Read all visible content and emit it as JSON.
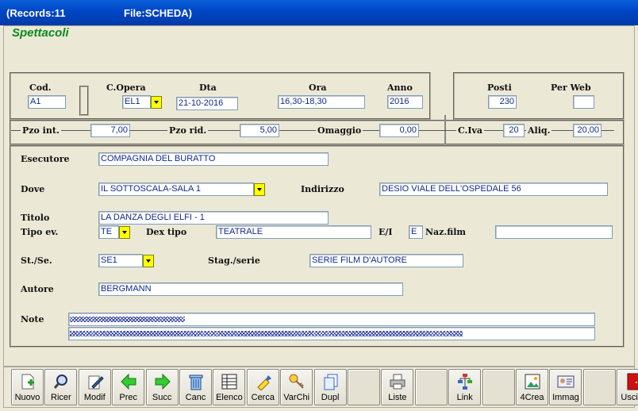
{
  "window": {
    "records": "(Records:11",
    "file": "File:SCHEDA)"
  },
  "form_title": "Spettacoli",
  "top": {
    "cod_label": "Cod.",
    "cod": "A1",
    "opera_label": "C.Opera",
    "opera": "EL1",
    "dta_label": "Dta",
    "dta": "21-10-2016",
    "ora_label": "Ora",
    "ora": "16,30-18,30",
    "anno_label": "Anno",
    "anno": "2016",
    "posti_label": "Posti",
    "posti": "230",
    "web_label": "Per Web",
    "web": ""
  },
  "prices": {
    "int_label": "Pzo int.",
    "int": "7,00",
    "rid_label": "Pzo rid.",
    "rid": "5,00",
    "omaggio_label": "Omaggio",
    "omaggio": "0,00",
    "civa_label": "C.Iva",
    "civa": "20",
    "aliq_label": "Aliq.",
    "aliq": "20,00"
  },
  "details": {
    "esecutore_label": "Esecutore",
    "esecutore": "COMPAGNIA DEL BURATTO",
    "dove_label": "Dove",
    "dove": "IL SOTTOSCALA-SALA 1",
    "indirizzo_label": "Indirizzo",
    "indirizzo": "DESIO  VIALE DELL'OSPEDALE 56",
    "titolo_label": "Titolo",
    "titolo": "LA DANZA DEGLI ELFI - 1",
    "tipo_label": "Tipo ev.",
    "tipo": "TE",
    "dex_label": "Dex tipo",
    "dex": "TEATRALE",
    "ei_label": "E/I",
    "ei": "E",
    "naz_label": "Naz.film",
    "naz": "",
    "stse_label": "St./Se.",
    "stse": "SE1",
    "stag_label": "Stag./serie",
    "stag": "SERIE FILM D'AUTORE",
    "autore_label": "Autore",
    "autore": "BERGMANN",
    "note_label": "Note",
    "note1": "",
    "note2": ""
  },
  "colors": {
    "accent_title": "#0a8a20",
    "field_text": "#102a8a",
    "dropdown": "#ffff00",
    "titlebar": "#0048c8"
  },
  "toolbar": [
    {
      "label": "Nuovo",
      "icon": "new-document-icon"
    },
    {
      "label": "Ricer",
      "icon": "search-icon"
    },
    {
      "label": "Modif",
      "icon": "edit-icon"
    },
    {
      "label": "Prec",
      "icon": "arrow-left-icon"
    },
    {
      "label": "Succ",
      "icon": "arrow-right-icon"
    },
    {
      "label": "Canc",
      "icon": "trash-icon"
    },
    {
      "label": "Elenco",
      "icon": "list-icon"
    },
    {
      "label": "Cerca",
      "icon": "highlighter-icon"
    },
    {
      "label": "VarChi",
      "icon": "keys-icon"
    },
    {
      "label": "Dupl",
      "icon": "copy-icon"
    },
    {
      "label": "",
      "icon": ""
    },
    {
      "label": "Liste",
      "icon": "printer-icon"
    },
    {
      "label": "",
      "icon": ""
    },
    {
      "label": "Link",
      "icon": "tree-icon"
    },
    {
      "label": "",
      "icon": ""
    },
    {
      "label": "4Crea",
      "icon": "image-create-icon"
    },
    {
      "label": "Immag",
      "icon": "id-card-icon"
    },
    {
      "label": "",
      "icon": ""
    },
    {
      "label": "Uscita",
      "icon": "exit-door-icon"
    }
  ]
}
